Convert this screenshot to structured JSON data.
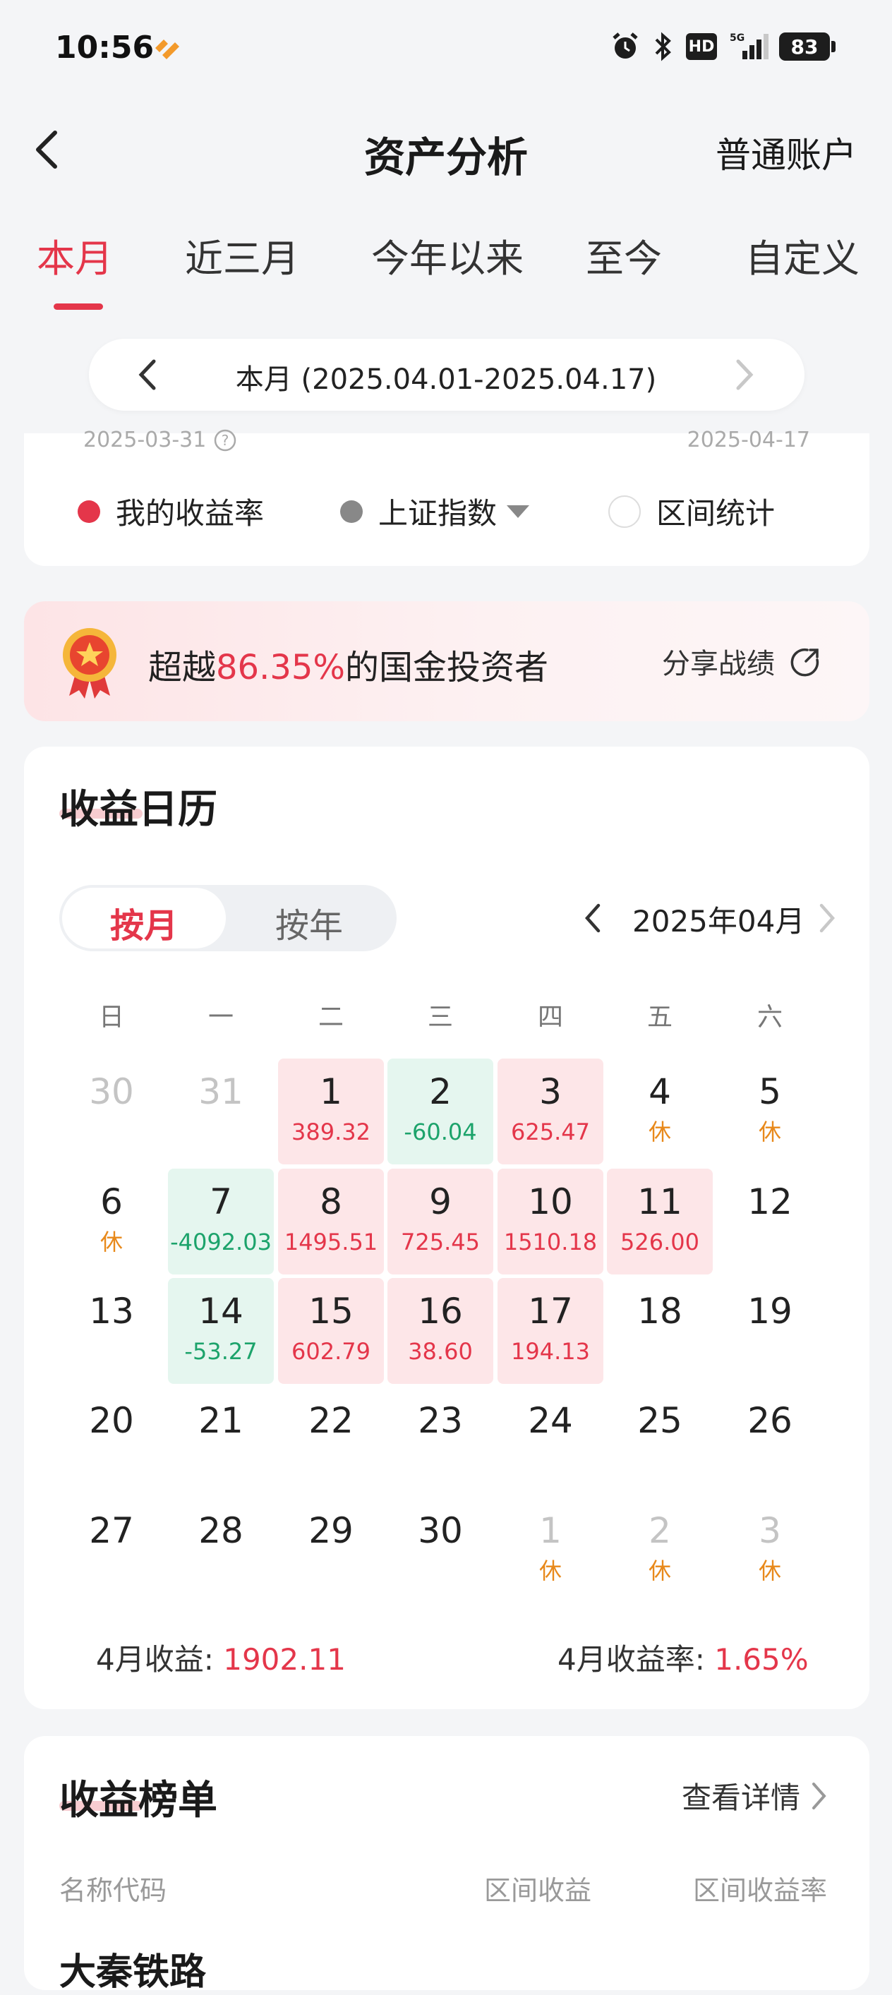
{
  "status_bar": {
    "time": "10:56",
    "hd": "HD",
    "net": "5G",
    "battery": "83"
  },
  "header": {
    "title": "资产分析",
    "account": "普通账户"
  },
  "tabs": [
    {
      "label": "本月"
    },
    {
      "label": "近三月"
    },
    {
      "label": "今年以来"
    },
    {
      "label": "至今"
    },
    {
      "label": "自定义"
    }
  ],
  "period": {
    "text": "本月 (2025.04.01-2025.04.17)"
  },
  "chart_range": {
    "start": "2025-03-31",
    "end": "2025-04-17"
  },
  "legend": {
    "mine": "我的收益率",
    "index": "上证指数",
    "stats": "区间统计"
  },
  "colors": {
    "accent": "#e4364a",
    "positive": "#e4364a",
    "negative": "#1ca36b",
    "rest": "#e8891b"
  },
  "rank_banner": {
    "prefix": "超越",
    "percent": "86.35%",
    "suffix": "的国金投资者",
    "share": "分享战绩"
  },
  "calendar": {
    "title": "收益日历",
    "seg": {
      "month": "按月",
      "year": "按年"
    },
    "month_label": "2025年04月",
    "weekdays": [
      "日",
      "一",
      "二",
      "三",
      "四",
      "五",
      "六"
    ],
    "rows": [
      [
        {
          "d": "30",
          "m": true
        },
        {
          "d": "31",
          "m": true
        },
        {
          "d": "1",
          "v": "389.32",
          "t": "pos"
        },
        {
          "d": "2",
          "v": "-60.04",
          "t": "neg"
        },
        {
          "d": "3",
          "v": "625.47",
          "t": "pos"
        },
        {
          "d": "4",
          "v": "休",
          "t": "rest"
        },
        {
          "d": "5",
          "v": "休",
          "t": "rest"
        }
      ],
      [
        {
          "d": "6",
          "v": "休",
          "t": "rest"
        },
        {
          "d": "7",
          "v": "-4092.03",
          "t": "neg"
        },
        {
          "d": "8",
          "v": "1495.51",
          "t": "pos"
        },
        {
          "d": "9",
          "v": "725.45",
          "t": "pos"
        },
        {
          "d": "10",
          "v": "1510.18",
          "t": "pos"
        },
        {
          "d": "11",
          "v": "526.00",
          "t": "pos"
        },
        {
          "d": "12"
        }
      ],
      [
        {
          "d": "13"
        },
        {
          "d": "14",
          "v": "-53.27",
          "t": "neg"
        },
        {
          "d": "15",
          "v": "602.79",
          "t": "pos"
        },
        {
          "d": "16",
          "v": "38.60",
          "t": "pos"
        },
        {
          "d": "17",
          "v": "194.13",
          "t": "pos"
        },
        {
          "d": "18"
        },
        {
          "d": "19"
        }
      ],
      [
        {
          "d": "20"
        },
        {
          "d": "21"
        },
        {
          "d": "22"
        },
        {
          "d": "23"
        },
        {
          "d": "24"
        },
        {
          "d": "25"
        },
        {
          "d": "26"
        }
      ],
      [
        {
          "d": "27"
        },
        {
          "d": "28"
        },
        {
          "d": "29"
        },
        {
          "d": "30"
        },
        {
          "d": "1",
          "m": true,
          "v": "休",
          "t": "rest"
        },
        {
          "d": "2",
          "m": true,
          "v": "休",
          "t": "rest"
        },
        {
          "d": "3",
          "m": true,
          "v": "休",
          "t": "rest"
        }
      ]
    ],
    "summary": {
      "income_label": "4月收益: ",
      "income_value": "1902.11",
      "rate_label": "4月收益率: ",
      "rate_value": "1.65%"
    }
  },
  "ranking": {
    "title": "收益榜单",
    "view_detail": "查看详情",
    "columns": [
      "名称代码",
      "区间收益",
      "区间收益率"
    ],
    "first_row_name": "大秦铁路"
  }
}
